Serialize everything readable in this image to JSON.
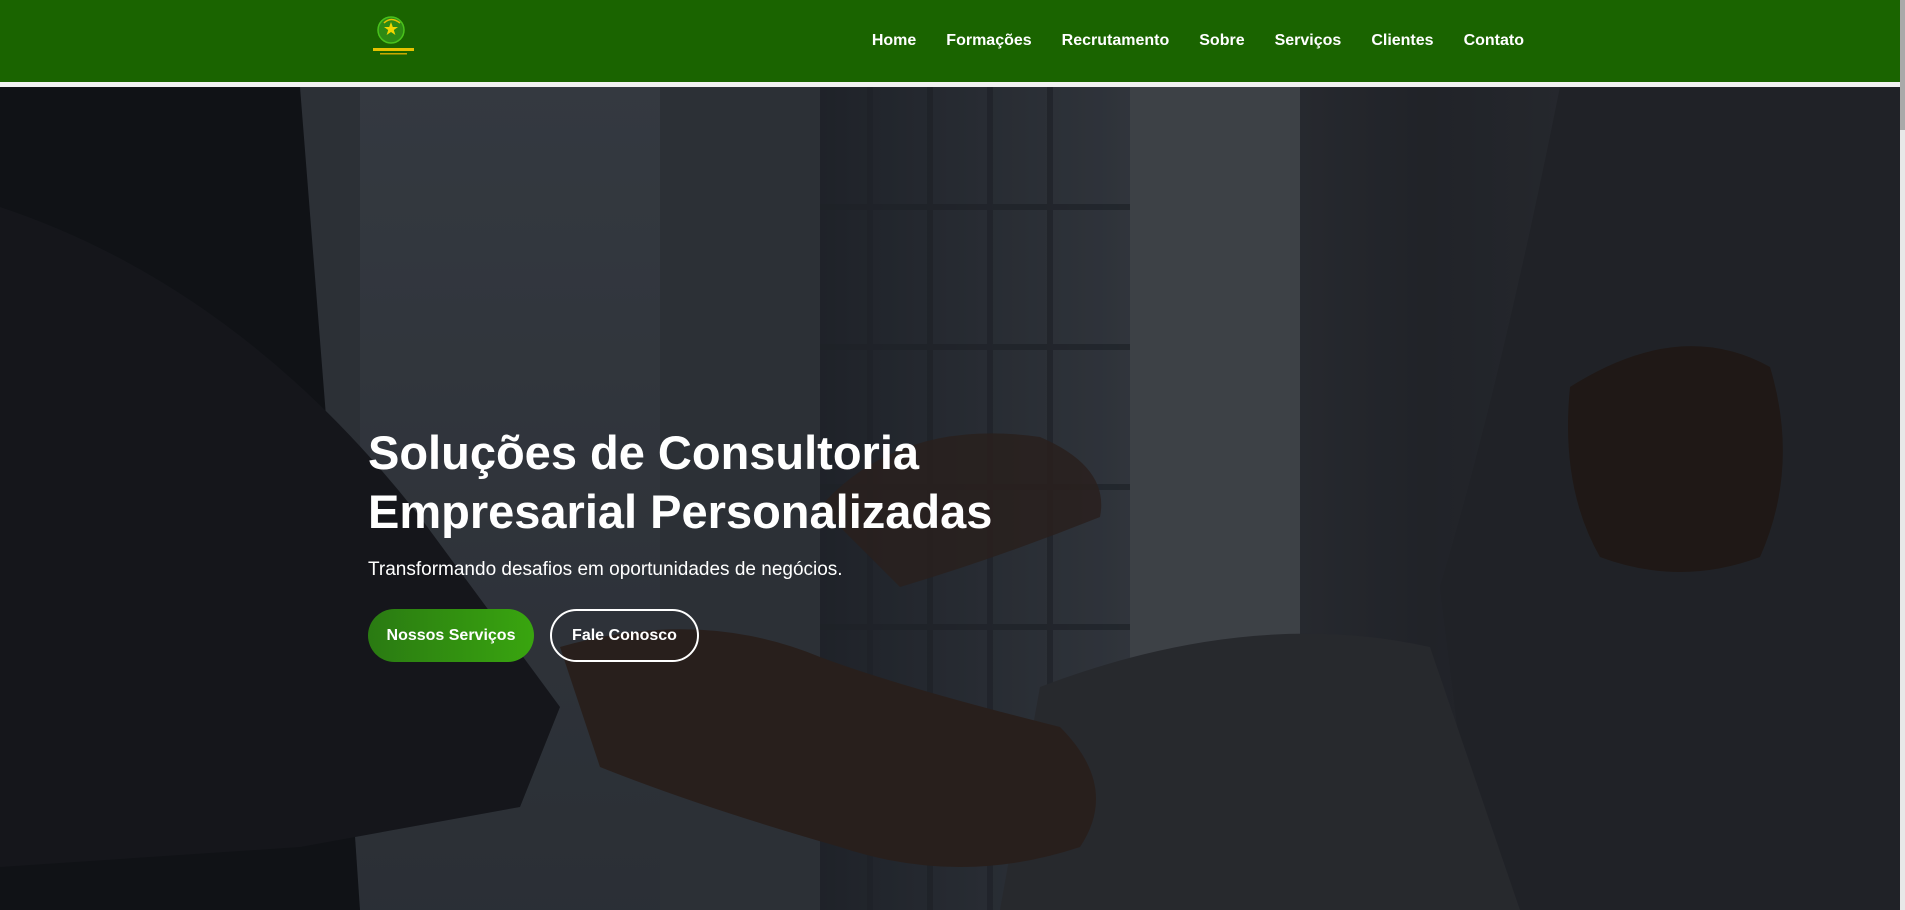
{
  "header": {
    "logo_icon": "company-logo",
    "nav": [
      {
        "label": "Home"
      },
      {
        "label": "Formações"
      },
      {
        "label": "Recrutamento"
      },
      {
        "label": "Sobre"
      },
      {
        "label": "Serviços"
      },
      {
        "label": "Clientes"
      },
      {
        "label": "Contato"
      }
    ]
  },
  "hero": {
    "title": "Soluções de Consultoria Empresarial Personalizadas",
    "subtitle": "Transformando desafios em oportunidades de negócios.",
    "primary_button": "Nossos Serviços",
    "secondary_button": "Fale Conosco"
  },
  "colors": {
    "header_green": "#1a6400",
    "button_green": "#39a50f",
    "text_white": "#ffffff"
  }
}
